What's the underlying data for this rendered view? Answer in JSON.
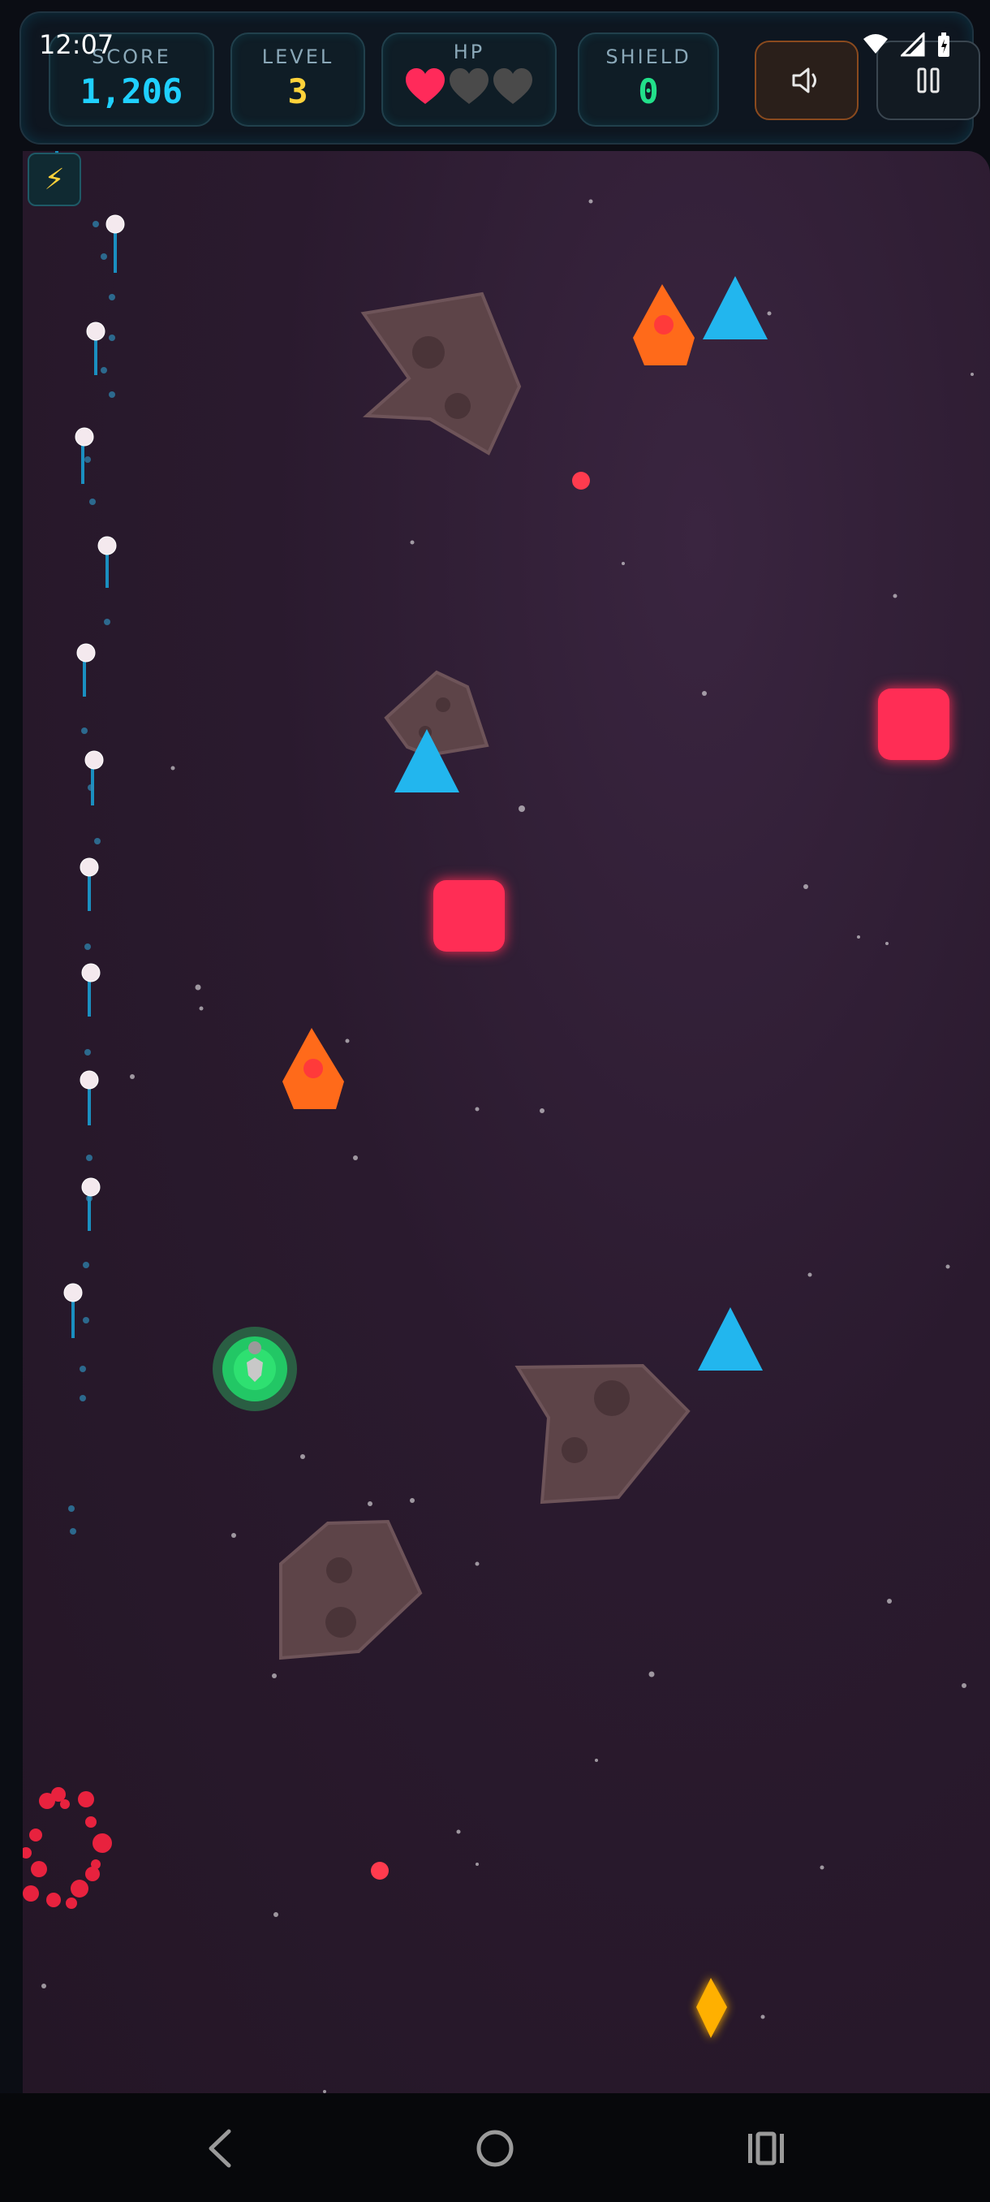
{
  "status_bar": {
    "time": "12:07"
  },
  "hud": {
    "score": {
      "label": "SCORE",
      "value": "1,206"
    },
    "level": {
      "label": "LEVEL",
      "value": "3"
    },
    "hp": {
      "label": "HP",
      "hearts_total": 3,
      "hearts_filled": 1
    },
    "shield": {
      "label": "SHIELD",
      "value": "0"
    },
    "sound_icon": "speaker-icon",
    "pause_icon": "pause-icon"
  },
  "powerup": {
    "icon": "lightning-bolt",
    "glyph": "⚡"
  },
  "colors": {
    "score": "#1fd0ff",
    "level": "#ffd23a",
    "shield": "#22e08a",
    "heart_full": "#ff2a5a",
    "heart_empty": "#4a4a4a",
    "enemy_square": "#ff2d55",
    "enemy_triangle": "#22b6ee",
    "enemy_drop": "#ff6a1a",
    "gem": "#ffb000",
    "player": "#2ee071"
  },
  "nav": {
    "back_icon": "back-icon",
    "home_icon": "home-icon",
    "recents_icon": "recents-icon"
  }
}
